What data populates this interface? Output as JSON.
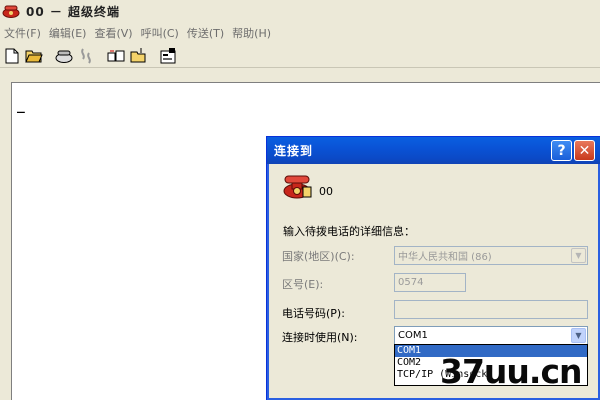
{
  "window": {
    "title": "00 － 超级终端"
  },
  "menu": [
    {
      "label": "文件(F)"
    },
    {
      "label": "编辑(E)"
    },
    {
      "label": "查看(V)"
    },
    {
      "label": "呼叫(C)"
    },
    {
      "label": "传送(T)"
    },
    {
      "label": "帮助(H)"
    }
  ],
  "toolbar": {
    "icons": [
      "new-icon",
      "open-icon",
      "dial-icon",
      "disconnect-icon",
      "send-icon",
      "receive-icon",
      "properties-icon"
    ]
  },
  "terminal": {
    "cursor": "_"
  },
  "dialog": {
    "title": "连接到",
    "help_label": "?",
    "close_label": "✕",
    "connection_name": "00",
    "prompt": "输入待拨电话的详细信息：",
    "country": {
      "label": "国家(地区)(C):",
      "value": "中华人民共和国 (86)"
    },
    "area_code": {
      "label": "区号(E):",
      "value": "0574"
    },
    "phone": {
      "label": "电话号码(P):",
      "value": ""
    },
    "connect_using": {
      "label": "连接时使用(N):",
      "value": "COM1",
      "options": [
        "COM1",
        "COM2",
        "TCP/IP (Winsock)"
      ],
      "selected_index": 0
    }
  },
  "watermark": "37uu.cn",
  "colors": {
    "title_blue": "#0a53d6",
    "selection": "#316ac5",
    "chrome": "#ece9d8"
  }
}
